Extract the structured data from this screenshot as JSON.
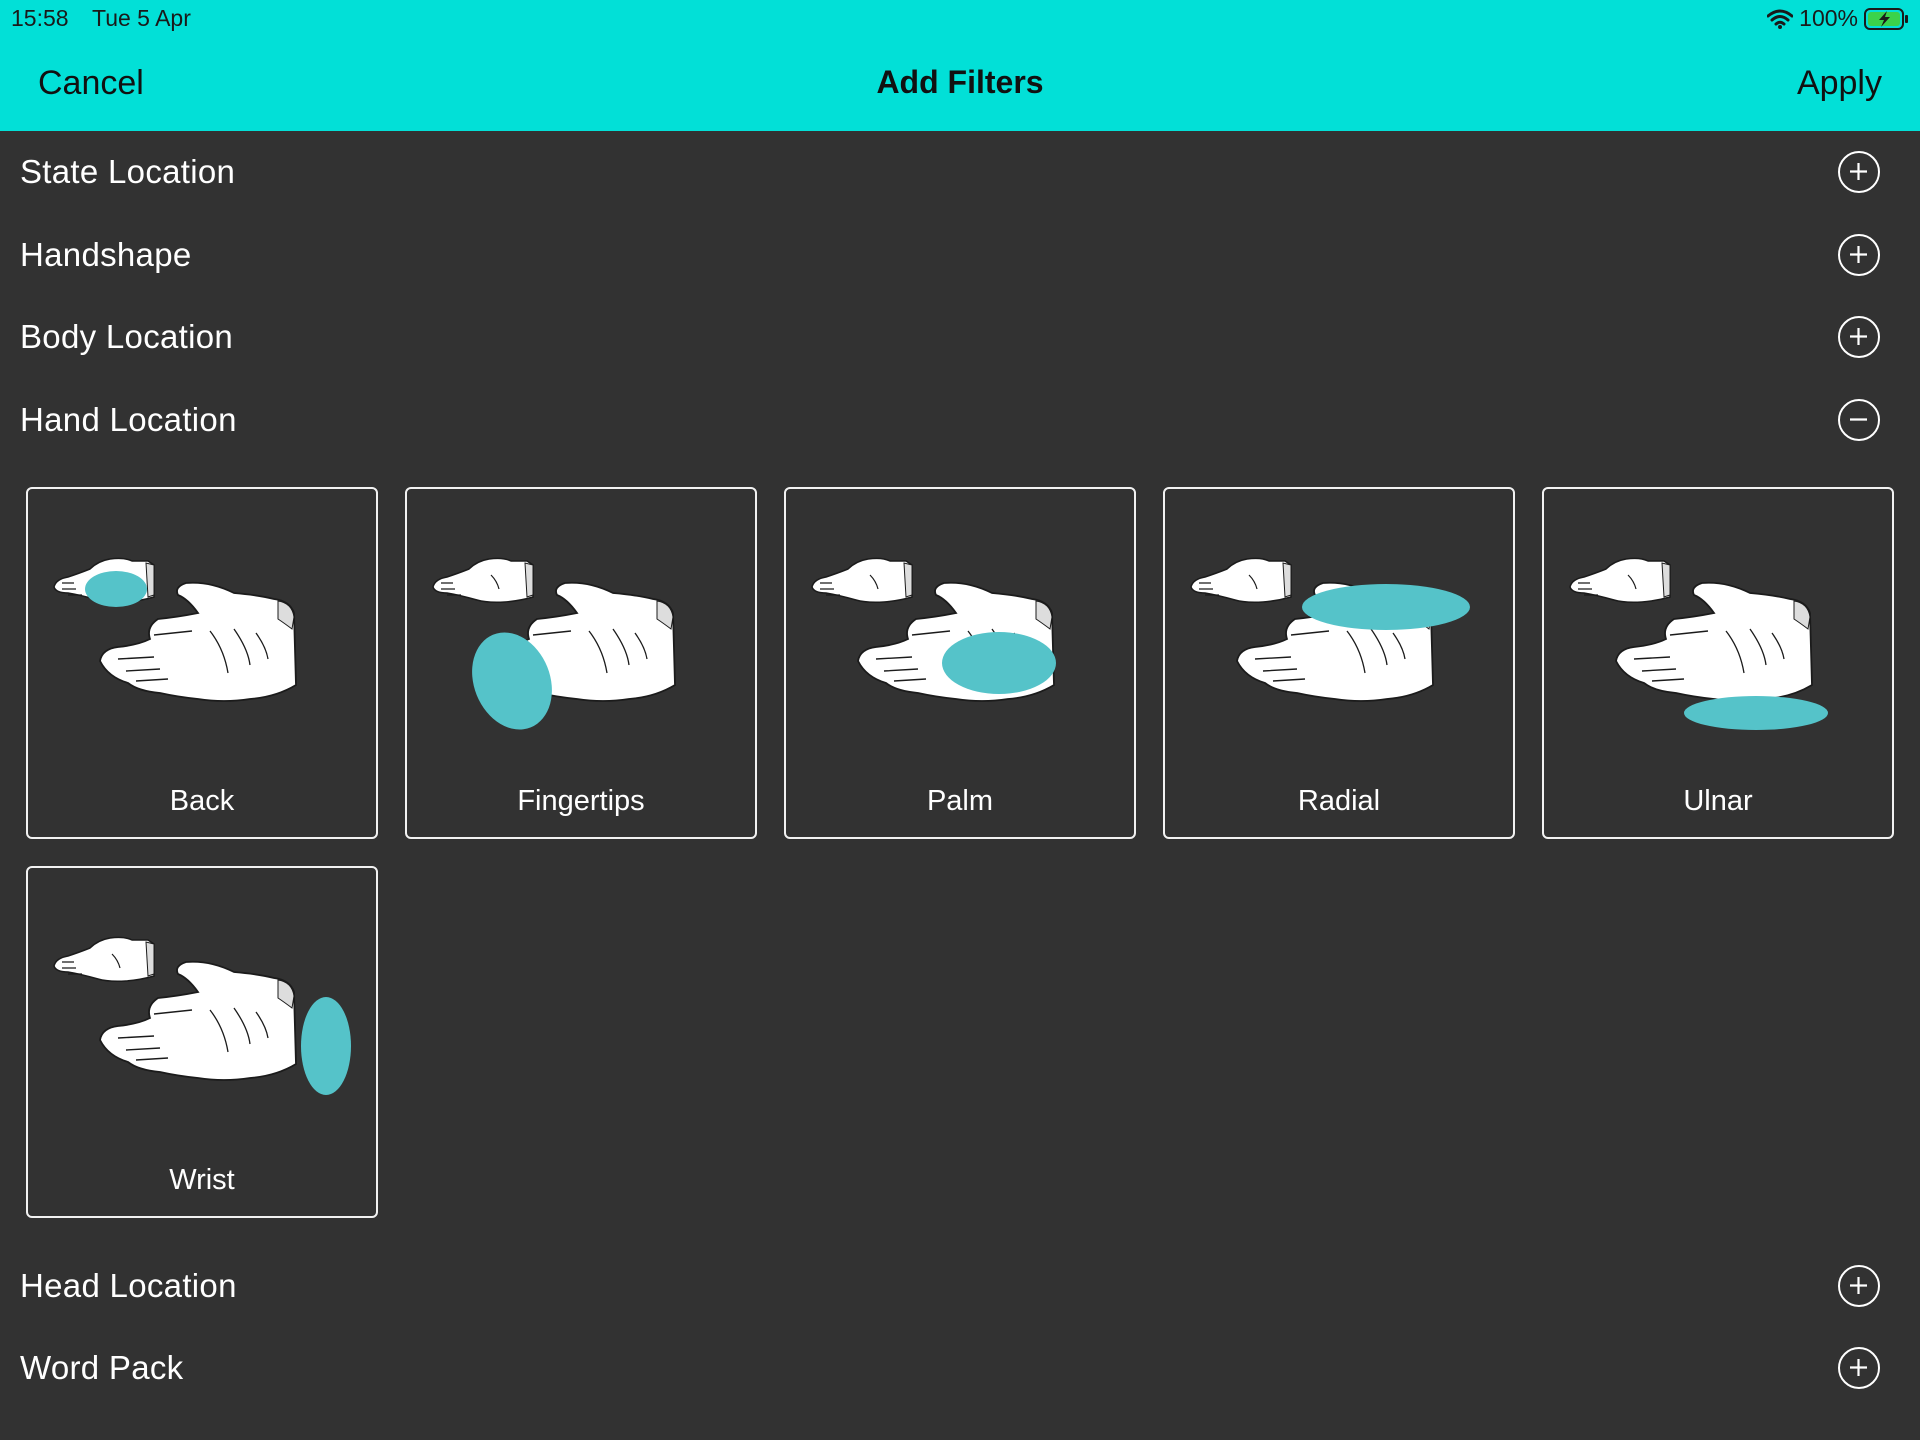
{
  "status": {
    "time": "15:58",
    "date": "Tue 5 Apr",
    "battery": "100%",
    "wifi_icon": "wifi-icon",
    "battery_icon": "battery-charging-icon"
  },
  "nav": {
    "cancel": "Cancel",
    "title": "Add Filters",
    "apply": "Apply"
  },
  "colors": {
    "accent": "#02e0d7",
    "background": "#323232",
    "highlight": "#55c3c9"
  },
  "sections": [
    {
      "label": "State Location",
      "state": "collapsed",
      "icon": "plus-circle-icon"
    },
    {
      "label": "Handshape",
      "state": "collapsed",
      "icon": "plus-circle-icon"
    },
    {
      "label": "Body Location",
      "state": "collapsed",
      "icon": "plus-circle-icon"
    },
    {
      "label": "Hand Location",
      "state": "expanded",
      "icon": "minus-circle-icon"
    },
    {
      "label": "Head Location",
      "state": "collapsed",
      "icon": "plus-circle-icon"
    },
    {
      "label": "Word Pack",
      "state": "collapsed",
      "icon": "plus-circle-icon"
    }
  ],
  "hand_location_options": [
    {
      "label": "Back"
    },
    {
      "label": "Fingertips"
    },
    {
      "label": "Palm"
    },
    {
      "label": "Radial"
    },
    {
      "label": "Ulnar"
    },
    {
      "label": "Wrist"
    }
  ]
}
